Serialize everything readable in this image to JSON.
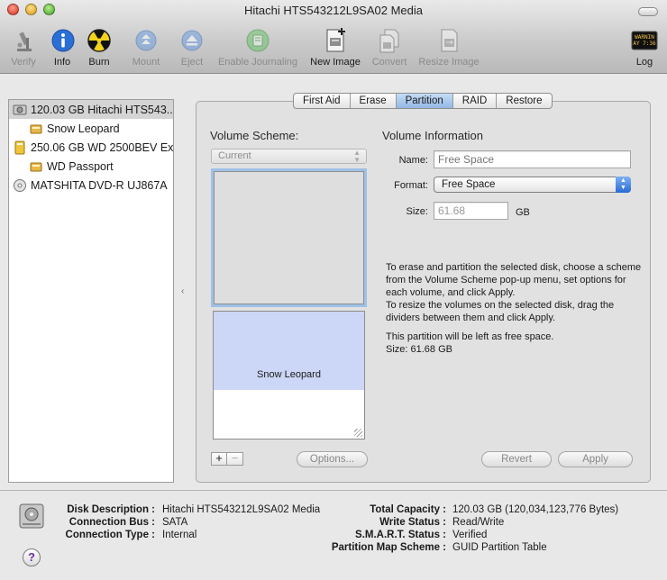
{
  "window": {
    "title": "Hitachi HTS543212L9SA02 Media"
  },
  "toolbar": {
    "items": [
      {
        "label": "Verify",
        "icon": "microscope-icon",
        "enabled": false
      },
      {
        "label": "Info",
        "icon": "info-icon",
        "enabled": true
      },
      {
        "label": "Burn",
        "icon": "burn-icon",
        "enabled": true
      },
      {
        "label": "Mount",
        "icon": "mount-icon",
        "enabled": false
      },
      {
        "label": "Eject",
        "icon": "eject-icon",
        "enabled": false
      },
      {
        "label": "Enable Journaling",
        "icon": "journaling-icon",
        "enabled": false
      },
      {
        "label": "New Image",
        "icon": "new-image-icon",
        "enabled": true
      },
      {
        "label": "Convert",
        "icon": "convert-icon",
        "enabled": false
      },
      {
        "label": "Resize Image",
        "icon": "resize-image-icon",
        "enabled": false
      },
      {
        "label": "Log",
        "icon": "log-icon",
        "enabled": true
      }
    ],
    "log_icon_text": "WARNIN\nAY 7:36"
  },
  "sidebar": {
    "items": [
      {
        "label": "120.03 GB Hitachi HTS543...",
        "icon": "hard-disk-icon",
        "indent": 0,
        "selected": true
      },
      {
        "label": "Snow Leopard",
        "icon": "volume-icon",
        "indent": 1,
        "selected": false
      },
      {
        "label": "250.06 GB WD 2500BEV Ex...",
        "icon": "external-disk-icon",
        "indent": 0,
        "selected": false
      },
      {
        "label": "WD Passport",
        "icon": "volume-icon",
        "indent": 1,
        "selected": false
      },
      {
        "label": "MATSHITA DVD-R UJ867A",
        "icon": "dvd-drive-icon",
        "indent": 0,
        "selected": false
      }
    ]
  },
  "tabs": [
    {
      "label": "First Aid",
      "active": false
    },
    {
      "label": "Erase",
      "active": false
    },
    {
      "label": "Partition",
      "active": true
    },
    {
      "label": "RAID",
      "active": false
    },
    {
      "label": "Restore",
      "active": false
    }
  ],
  "partition": {
    "volume_scheme_title": "Volume Scheme:",
    "volume_scheme_value": "Current",
    "partition_name": "Snow Leopard",
    "add_label": "+",
    "remove_label": "−",
    "options_label": "Options...",
    "revert_label": "Revert",
    "apply_label": "Apply",
    "volume_info_title": "Volume Information",
    "name_label": "Name:",
    "name_placeholder": "Free Space",
    "format_label": "Format:",
    "format_value": "Free Space",
    "size_label": "Size:",
    "size_value": "61.68",
    "size_unit": "GB",
    "help_lines": [
      "To erase and partition the selected disk, choose a scheme from the Volume Scheme pop-up menu, set options for each volume, and click Apply.",
      "To resize the volumes on the selected disk, drag the dividers between them and click Apply."
    ],
    "status_lines": [
      "This partition will be left as free space.",
      "Size: 61.68 GB"
    ]
  },
  "disk_info": {
    "left": [
      {
        "key": "Disk Description :",
        "value": "Hitachi HTS543212L9SA02 Media"
      },
      {
        "key": "Connection Bus :",
        "value": "SATA"
      },
      {
        "key": "Connection Type :",
        "value": "Internal"
      }
    ],
    "right": [
      {
        "key": "Total Capacity :",
        "value": "120.03 GB (120,034,123,776 Bytes)"
      },
      {
        "key": "Write Status :",
        "value": "Read/Write"
      },
      {
        "key": "S.M.A.R.T. Status :",
        "value": "Verified"
      },
      {
        "key": "Partition Map Scheme :",
        "value": "GUID Partition Table"
      }
    ],
    "help_label": "?"
  },
  "colors": {
    "selection": "#d4d4d4",
    "active_tab": "#92b8e6",
    "partition_fill": "#ccd6f6",
    "focus_ring": "#9fc1e6"
  }
}
